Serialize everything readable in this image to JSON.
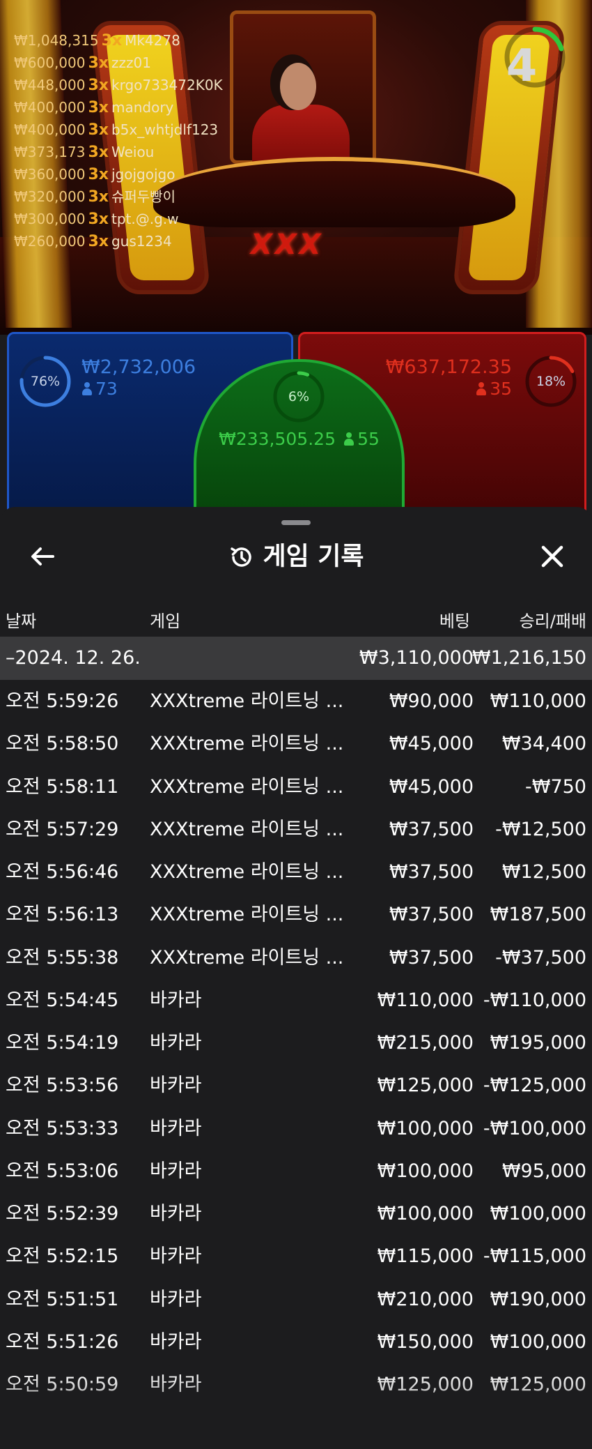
{
  "stream": {
    "logo": "XXX",
    "timer": "4",
    "winners": [
      {
        "amount": "₩1,048,315",
        "mult": "3x",
        "user": "Mk4278"
      },
      {
        "amount": "₩600,000",
        "mult": "3x",
        "user": "zzz01"
      },
      {
        "amount": "₩448,000",
        "mult": "3x",
        "user": "krgo733472K0K"
      },
      {
        "amount": "₩400,000",
        "mult": "3x",
        "user": "mandory"
      },
      {
        "amount": "₩400,000",
        "mult": "3x",
        "user": "b5x_whtjdlf123"
      },
      {
        "amount": "₩373,173",
        "mult": "3x",
        "user": "Weiou"
      },
      {
        "amount": "₩360,000",
        "mult": "3x",
        "user": "jgojgojgo"
      },
      {
        "amount": "₩320,000",
        "mult": "3x",
        "user": "슈퍼두빵이"
      },
      {
        "amount": "₩300,000",
        "mult": "3x",
        "user": "tpt.@.g.w"
      },
      {
        "amount": "₩260,000",
        "mult": "3x",
        "user": "gus1234"
      }
    ]
  },
  "bets": {
    "player": {
      "percent": "76%",
      "percent_value": 0.76,
      "total": "₩2,732,006",
      "players": "73",
      "color": "#3d7fe0"
    },
    "tie": {
      "percent": "6%",
      "percent_value": 0.06,
      "total": "₩233,505.25",
      "players": "55",
      "color": "#3ccd4a"
    },
    "banker": {
      "percent": "18%",
      "percent_value": 0.18,
      "total": "₩637,172.35",
      "players": "35",
      "color": "#e0301e"
    }
  },
  "history": {
    "title": "게임 기록",
    "columns": {
      "date": "날짜",
      "game": "게임",
      "bet": "베팅",
      "winloss": "승리/패배"
    },
    "date_row": {
      "date": "–2024. 12. 26.",
      "bet": "₩3,110,000",
      "winloss": "₩1,216,150"
    },
    "rows": [
      {
        "time": "오전 5:59:26",
        "game": "XXXtreme 라이트닝 ...",
        "bet": "₩90,000",
        "winloss": "₩110,000"
      },
      {
        "time": "오전 5:58:50",
        "game": "XXXtreme 라이트닝 ...",
        "bet": "₩45,000",
        "winloss": "₩34,400"
      },
      {
        "time": "오전 5:58:11",
        "game": "XXXtreme 라이트닝 ...",
        "bet": "₩45,000",
        "winloss": "-₩750"
      },
      {
        "time": "오전 5:57:29",
        "game": "XXXtreme 라이트닝 ...",
        "bet": "₩37,500",
        "winloss": "-₩12,500"
      },
      {
        "time": "오전 5:56:46",
        "game": "XXXtreme 라이트닝 ...",
        "bet": "₩37,500",
        "winloss": "₩12,500"
      },
      {
        "time": "오전 5:56:13",
        "game": "XXXtreme 라이트닝 ...",
        "bet": "₩37,500",
        "winloss": "₩187,500"
      },
      {
        "time": "오전 5:55:38",
        "game": "XXXtreme 라이트닝 ...",
        "bet": "₩37,500",
        "winloss": "-₩37,500"
      },
      {
        "time": "오전 5:54:45",
        "game": "바카라",
        "bet": "₩110,000",
        "winloss": "-₩110,000"
      },
      {
        "time": "오전 5:54:19",
        "game": "바카라",
        "bet": "₩215,000",
        "winloss": "₩195,000"
      },
      {
        "time": "오전 5:53:56",
        "game": "바카라",
        "bet": "₩125,000",
        "winloss": "-₩125,000"
      },
      {
        "time": "오전 5:53:33",
        "game": "바카라",
        "bet": "₩100,000",
        "winloss": "-₩100,000"
      },
      {
        "time": "오전 5:53:06",
        "game": "바카라",
        "bet": "₩100,000",
        "winloss": "₩95,000"
      },
      {
        "time": "오전 5:52:39",
        "game": "바카라",
        "bet": "₩100,000",
        "winloss": "₩100,000"
      },
      {
        "time": "오전 5:52:15",
        "game": "바카라",
        "bet": "₩115,000",
        "winloss": "-₩115,000"
      },
      {
        "time": "오전 5:51:51",
        "game": "바카라",
        "bet": "₩210,000",
        "winloss": "₩190,000"
      },
      {
        "time": "오전 5:51:26",
        "game": "바카라",
        "bet": "₩150,000",
        "winloss": "₩100,000"
      },
      {
        "time": "오전 5:50:59",
        "game": "바카라",
        "bet": "₩125,000",
        "winloss": "₩125,000"
      }
    ]
  }
}
